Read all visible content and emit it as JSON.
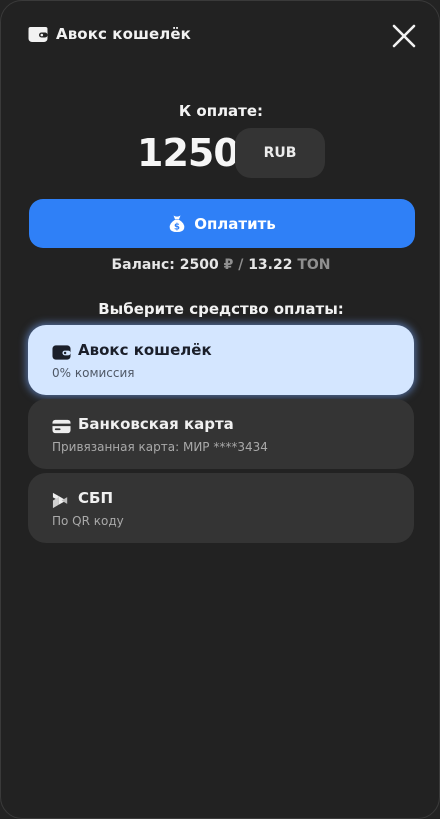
{
  "header": {
    "title": "Авокс кошелёк",
    "icon": "wallet-icon",
    "close_icon": "close-icon"
  },
  "payment": {
    "label": "К оплате:",
    "amount": "1250",
    "currency": "RUB",
    "pay_button": "Оплатить",
    "pay_icon": "money-bag-icon"
  },
  "balance": {
    "prefix": "Баланс: 2500",
    "rub_sign": "₽",
    "separator": "/",
    "ton_amount": "13.22",
    "ton_label": "TON"
  },
  "methods_title": "Выберите средство оплаты:",
  "methods": [
    {
      "title": "Авокс кошелёк",
      "subtitle": "0% комиссия",
      "icon": "wallet-icon",
      "selected": true
    },
    {
      "title": "Банковская карта",
      "subtitle": "Привязанная карта: МИР ****3434",
      "icon": "credit-card-icon",
      "selected": false
    },
    {
      "title": "СБП",
      "subtitle": "По QR коду",
      "icon": "sbp-icon",
      "selected": false
    }
  ],
  "colors": {
    "background": "#222222",
    "accent": "#2f80f7",
    "selected_card": "#d4e6ff",
    "card": "#343434"
  }
}
